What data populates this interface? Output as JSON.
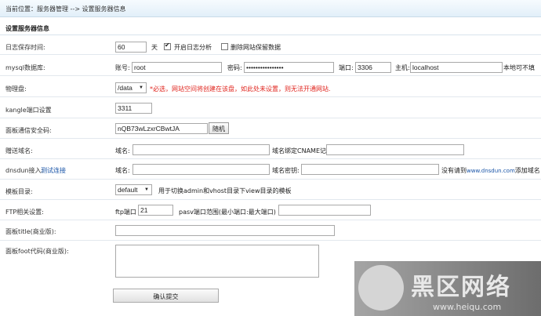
{
  "breadcrumb": "当前位置：服务器管理 --> 设置服务器信息",
  "section_title": "设置服务器信息",
  "log": {
    "label": "日志保存时间:",
    "value": "60",
    "unit": "天",
    "analysis_checked": true,
    "analysis_label": "开启日志分析",
    "delete_checked": false,
    "delete_label": "删除网站保留数据"
  },
  "mysql": {
    "label": "mysql数据库:",
    "account_label": "账号:",
    "account_value": "root",
    "password_label": "密码:",
    "password_value": "••••••••••••••••",
    "port_label": "端口:",
    "port_value": "3306",
    "host_label": "主机:",
    "host_value": "localhost",
    "note": "本地可不填"
  },
  "disk": {
    "label": "物理盘:",
    "selected": "/data",
    "warning": "*必选，网站空间将创建在该盘，如此处未设置，则无法开通网站."
  },
  "kangle": {
    "label": "kangle端口设置",
    "value": "3311"
  },
  "security": {
    "label": "面板通信安全码:",
    "value": "nQB73wLzxrCBwtJA",
    "random_button": "随机"
  },
  "gift_domain": {
    "label": "赠送域名:",
    "domain_label": "域名:",
    "cname_label": "域名绑定CNAME记录",
    "domain_value": "",
    "cname_value": ""
  },
  "dnsdun": {
    "label": "dnsdun接入:",
    "test_link": "测试连接",
    "domain_label": "域名:",
    "key_label": "域名密钥:",
    "note_pre": "没有请到",
    "note_url": "www.dnsdun.com",
    "note_post": "添加域名"
  },
  "template": {
    "label": "模板目录:",
    "selected": "default",
    "note": "用于切换admin和vhost目录下view目录的模板"
  },
  "ftp": {
    "label": "FTP相关设置:",
    "port_label": "ftp端口",
    "port_value": "21",
    "pasv_label": "pasv端口范围(最小端口:最大端口)",
    "pasv_value": ""
  },
  "panel_title": {
    "label": "面板title(商业版):",
    "value": ""
  },
  "panel_foot": {
    "label": "面板foot代码(商业版):",
    "value": ""
  },
  "submit_label": "确认提交",
  "watermark": {
    "title": "黑区网络",
    "url": "www.heiqu.com"
  }
}
